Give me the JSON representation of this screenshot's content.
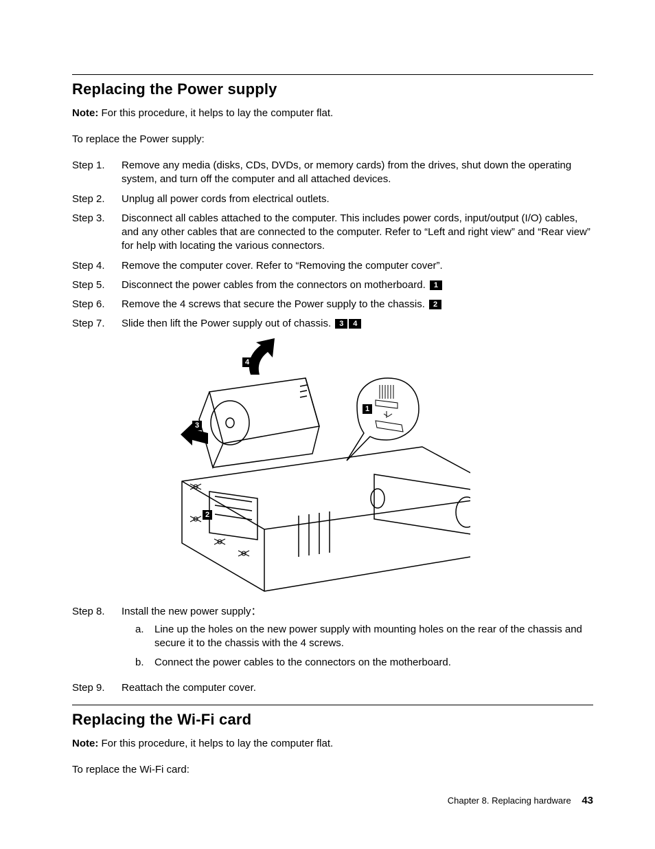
{
  "section1": {
    "title": "Replacing the Power supply",
    "note_label": "Note:",
    "note_text": " For this procedure, it helps to lay the computer flat.",
    "intro": "To replace the Power supply:",
    "steps": [
      {
        "label": "Step 1.",
        "text": "Remove any media (disks, CDs, DVDs, or memory cards) from the drives, shut down the operating system, and turn off the computer and all attached devices.",
        "callouts": []
      },
      {
        "label": "Step 2.",
        "text": "Unplug all power cords from electrical outlets.",
        "callouts": []
      },
      {
        "label": "Step 3.",
        "text": "Disconnect all cables attached to the computer.  This includes power cords, input/output (I/O) cables, and any other cables that are connected to the computer.  Refer to “Left and right view” and “Rear view” for help with locating the various connectors.",
        "callouts": []
      },
      {
        "label": "Step 4.",
        "text": "Remove the computer cover.  Refer to “Removing the computer cover”.",
        "callouts": []
      },
      {
        "label": "Step 5.",
        "text": "Disconnect the power cables from the connectors on motherboard.",
        "callouts": [
          "1"
        ]
      },
      {
        "label": "Step 6.",
        "text": "Remove the 4 screws that secure the Power supply to the chassis.",
        "callouts": [
          "2"
        ]
      },
      {
        "label": "Step 7.",
        "text": "Slide then lift the Power supply out of chassis.",
        "callouts": [
          "3",
          "4"
        ]
      }
    ],
    "steps_after_figure": [
      {
        "label": "Step 8.",
        "text": "Install the new power supply：",
        "callouts": [],
        "sub": [
          {
            "label": "a.",
            "text": "Line up the holes on the new power supply with mounting holes on the rear of the chassis and secure it to the chassis with the 4 screws."
          },
          {
            "label": "b.",
            "text": "Connect the power cables to the connectors on the motherboard."
          }
        ]
      },
      {
        "label": "Step 9.",
        "text": "Reattach the computer cover.",
        "callouts": []
      }
    ],
    "figure_callouts": {
      "c1": "1",
      "c2": "2",
      "c3": "3",
      "c4": "4"
    }
  },
  "section2": {
    "title": "Replacing the Wi-Fi card",
    "note_label": "Note:",
    "note_text": " For this procedure, it helps to lay the computer flat.",
    "intro": "To replace the Wi-Fi card:"
  },
  "footer": {
    "chapter": "Chapter 8.  Replacing hardware",
    "page": "43"
  }
}
